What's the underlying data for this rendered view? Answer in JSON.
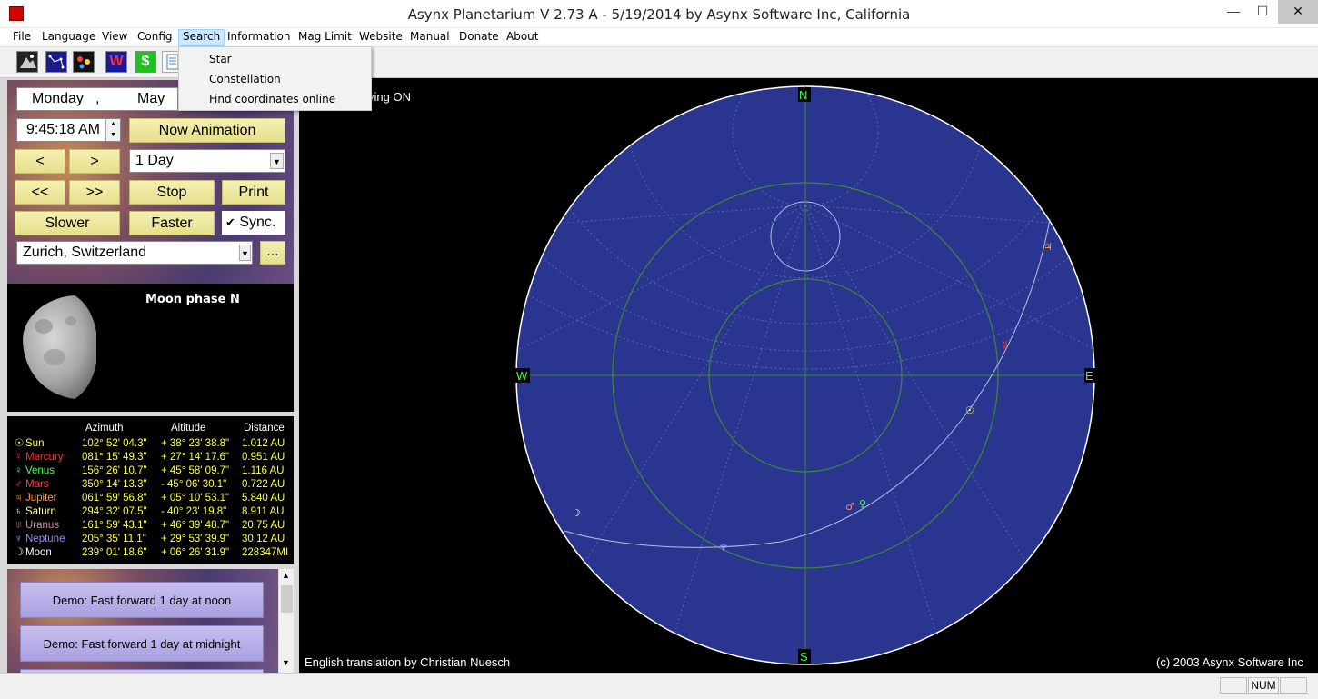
{
  "window": {
    "title": "Asynx Planetarium V 2.73 A - 5/19/2014 by Asynx Software Inc, California",
    "min": "—",
    "max": "☐",
    "close": "✕"
  },
  "menu": [
    "File",
    "Language",
    "View",
    "Config",
    "Search",
    "Information",
    "Mag Limit",
    "Website",
    "Manual",
    "Donate",
    "About"
  ],
  "search_menu": [
    "Star",
    "Constellation",
    "Find coordinates online"
  ],
  "toolbar": {
    "w_label": "W",
    "dollar_label": "$"
  },
  "controls": {
    "day": "Monday",
    "sep": ",",
    "month": "May",
    "time": "9:45:18 AM",
    "now_animation": "Now Animation",
    "prev": "<",
    "next": ">",
    "step": "1 Day",
    "rewind": "<<",
    "forward": ">>",
    "stop": "Stop",
    "print": "Print",
    "slower": "Slower",
    "faster": "Faster",
    "sync": "Sync.",
    "sync_checked": true,
    "location": "Zurich, Switzerland",
    "browse": "..."
  },
  "moon_phase": {
    "title": "Moon phase  N"
  },
  "table": {
    "headers": [
      "Azimuth",
      "Altitude",
      "Distance"
    ],
    "rows": [
      {
        "sym": "☉",
        "name": "Sun",
        "color": "#ffff40",
        "az": "102° 52' 04.3\"",
        "alt": "+ 38° 23' 38.8\"",
        "dist": "1.012 AU"
      },
      {
        "sym": "☿",
        "name": "Mercury",
        "color": "#ff3030",
        "az": "081° 15' 49.3\"",
        "alt": "+ 27° 14' 17.6\"",
        "dist": "0.951 AU"
      },
      {
        "sym": "♀",
        "name": "Venus",
        "color": "#40ff40",
        "az": "156° 26' 10.7\"",
        "alt": "+ 45° 58' 09.7\"",
        "dist": "1.116 AU"
      },
      {
        "sym": "♂",
        "name": "Mars",
        "color": "#ff4040",
        "az": "350° 14' 13.3\"",
        "alt": "-  45° 06' 30.1\"",
        "dist": "0.722 AU"
      },
      {
        "sym": "♃",
        "name": "Jupiter",
        "color": "#ff9a40",
        "az": "061° 59' 56.8\"",
        "alt": "+ 05° 10' 53.1\"",
        "dist": "5.840 AU"
      },
      {
        "sym": "♄",
        "name": "Saturn",
        "color": "#ffffa0",
        "az": "294° 32' 07.5\"",
        "alt": "-  40° 23' 19.8\"",
        "dist": "8.911 AU"
      },
      {
        "sym": "♅",
        "name": "Uranus",
        "color": "#d08aa0",
        "az": "161° 59' 43.1\"",
        "alt": "+ 46° 39' 48.7\"",
        "dist": "20.75 AU"
      },
      {
        "sym": "♆",
        "name": "Neptune",
        "color": "#8a8aff",
        "az": "205° 35' 11.1\"",
        "alt": "+ 29° 53' 39.9\"",
        "dist": "30.12 AU"
      },
      {
        "sym": "☽",
        "name": "Moon",
        "color": "#ffffff",
        "az": "239° 01' 18.6\"",
        "alt": "+ 06° 26' 31.9\"",
        "dist": "228347MI"
      }
    ]
  },
  "demos": [
    "Demo: Fast forward 1 day at noon",
    "Demo: Fast forward 1 day at midnight"
  ],
  "sky": {
    "saving": "ving ON",
    "north": "N",
    "south": "S",
    "east": "E",
    "west": "W",
    "credit": "English translation by Christian Nuesch",
    "copyright": "(c) 2003 Asynx Software Inc",
    "disk_color": "#2a3590",
    "ecliptic_color": "#3a8a3a",
    "bodies": [
      {
        "sym": "♃",
        "color": "#ff9a40"
      },
      {
        "sym": "☿",
        "color": "#ff3030"
      },
      {
        "sym": "☉",
        "color": "#ffff40"
      },
      {
        "sym": "♀",
        "color": "#40ff40"
      },
      {
        "sym": "♂",
        "color": "#ff8080"
      },
      {
        "sym": "☽",
        "color": "#ffffff"
      },
      {
        "sym": "♆",
        "color": "#a0a0ff"
      }
    ]
  },
  "status": {
    "num": "NUM"
  }
}
